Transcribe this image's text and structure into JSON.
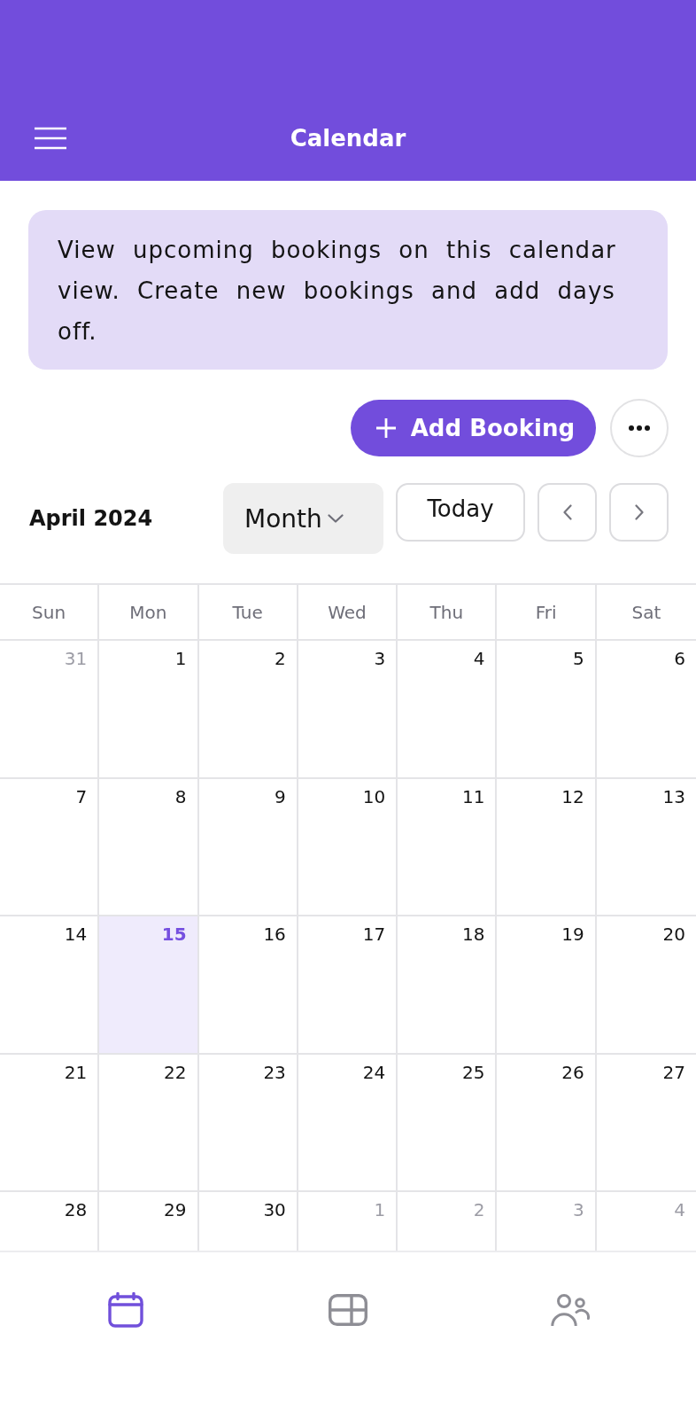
{
  "header": {
    "title": "Calendar"
  },
  "notice": {
    "text": "View upcoming bookings on this calendar view. Create new bookings and add days off."
  },
  "actions": {
    "add_button": {
      "label": "Add Booking"
    }
  },
  "calendar_toolbar": {
    "title": "April 2024",
    "view_select": {
      "value": "Month"
    },
    "today_button": {
      "label": "Today"
    }
  },
  "calendar": {
    "weekdays": [
      "Sun",
      "Mon",
      "Tue",
      "Wed",
      "Thu",
      "Fri",
      "Sat"
    ],
    "weeks": [
      {
        "days": [
          {
            "day": "31",
            "outside": true,
            "today": false
          },
          {
            "day": "1",
            "outside": false,
            "today": false
          },
          {
            "day": "2",
            "outside": false,
            "today": false
          },
          {
            "day": "3",
            "outside": false,
            "today": false
          },
          {
            "day": "4",
            "outside": false,
            "today": false
          },
          {
            "day": "5",
            "outside": false,
            "today": false
          },
          {
            "day": "6",
            "outside": false,
            "today": false
          }
        ]
      },
      {
        "days": [
          {
            "day": "7",
            "outside": false,
            "today": false
          },
          {
            "day": "8",
            "outside": false,
            "today": false
          },
          {
            "day": "9",
            "outside": false,
            "today": false
          },
          {
            "day": "10",
            "outside": false,
            "today": false
          },
          {
            "day": "11",
            "outside": false,
            "today": false
          },
          {
            "day": "12",
            "outside": false,
            "today": false
          },
          {
            "day": "13",
            "outside": false,
            "today": false
          }
        ]
      },
      {
        "days": [
          {
            "day": "14",
            "outside": false,
            "today": false
          },
          {
            "day": "15",
            "outside": false,
            "today": true
          },
          {
            "day": "16",
            "outside": false,
            "today": false
          },
          {
            "day": "17",
            "outside": false,
            "today": false
          },
          {
            "day": "18",
            "outside": false,
            "today": false
          },
          {
            "day": "19",
            "outside": false,
            "today": false
          },
          {
            "day": "20",
            "outside": false,
            "today": false
          }
        ]
      },
      {
        "days": [
          {
            "day": "21",
            "outside": false,
            "today": false
          },
          {
            "day": "22",
            "outside": false,
            "today": false
          },
          {
            "day": "23",
            "outside": false,
            "today": false
          },
          {
            "day": "24",
            "outside": false,
            "today": false
          },
          {
            "day": "25",
            "outside": false,
            "today": false
          },
          {
            "day": "26",
            "outside": false,
            "today": false
          },
          {
            "day": "27",
            "outside": false,
            "today": false
          }
        ]
      },
      {
        "days": [
          {
            "day": "28",
            "outside": false,
            "today": false
          },
          {
            "day": "29",
            "outside": false,
            "today": false
          },
          {
            "day": "30",
            "outside": false,
            "today": false
          },
          {
            "day": "1",
            "outside": true,
            "today": false
          },
          {
            "day": "2",
            "outside": true,
            "today": false
          },
          {
            "day": "3",
            "outside": true,
            "today": false
          },
          {
            "day": "4",
            "outside": true,
            "today": false
          }
        ]
      }
    ]
  },
  "bottom_nav": [
    {
      "selected": true
    },
    {
      "selected": false
    },
    {
      "selected": false
    }
  ]
}
